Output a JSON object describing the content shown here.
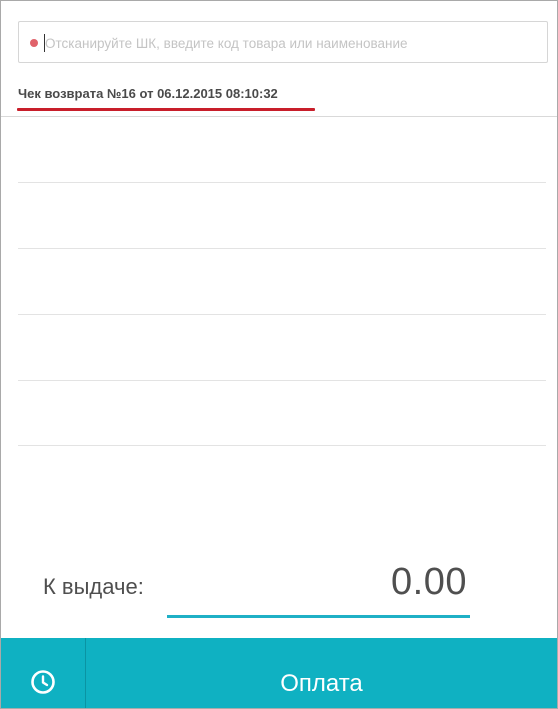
{
  "search": {
    "value": "",
    "placeholder": "Отсканируйте ШК, введите код товара или наименование"
  },
  "receipt": {
    "title": "Чек возврата №16 от 06.12.2015 08:10:32"
  },
  "total": {
    "label": "К выдаче:",
    "value": "0.00"
  },
  "footer": {
    "history_icon": "clock-icon",
    "pay_label": "Оплата"
  },
  "colors": {
    "accent": "#0fb1c2",
    "underline_red": "#c81e2a",
    "status_dot": "#e0626a"
  }
}
